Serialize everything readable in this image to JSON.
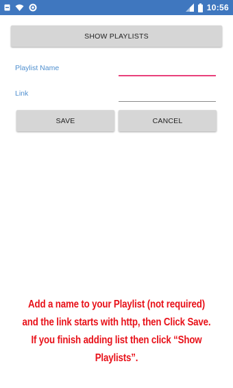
{
  "status_bar": {
    "time": "10:56",
    "icons": [
      "notification-icon",
      "wifi-icon",
      "sync-icon",
      "signal-icon",
      "battery-icon"
    ],
    "background_color": "#3f77bf"
  },
  "main": {
    "show_playlists_button": "Show Playlists",
    "playlist_name_label": "Playlist Name",
    "playlist_name_value": "",
    "link_label": "Link",
    "link_value": "",
    "save_button": "Save",
    "cancel_button": "Cancel"
  },
  "instructions": "Add a name to your Playlist (not required) and the link starts with http, then Click Save. If you finish adding list then click “Show Playlists”.",
  "colors": {
    "label": "#4f8fcf",
    "active_underline": "#e8407a",
    "instruction_text": "#e8121a",
    "button_bg": "#d6d6d6"
  }
}
